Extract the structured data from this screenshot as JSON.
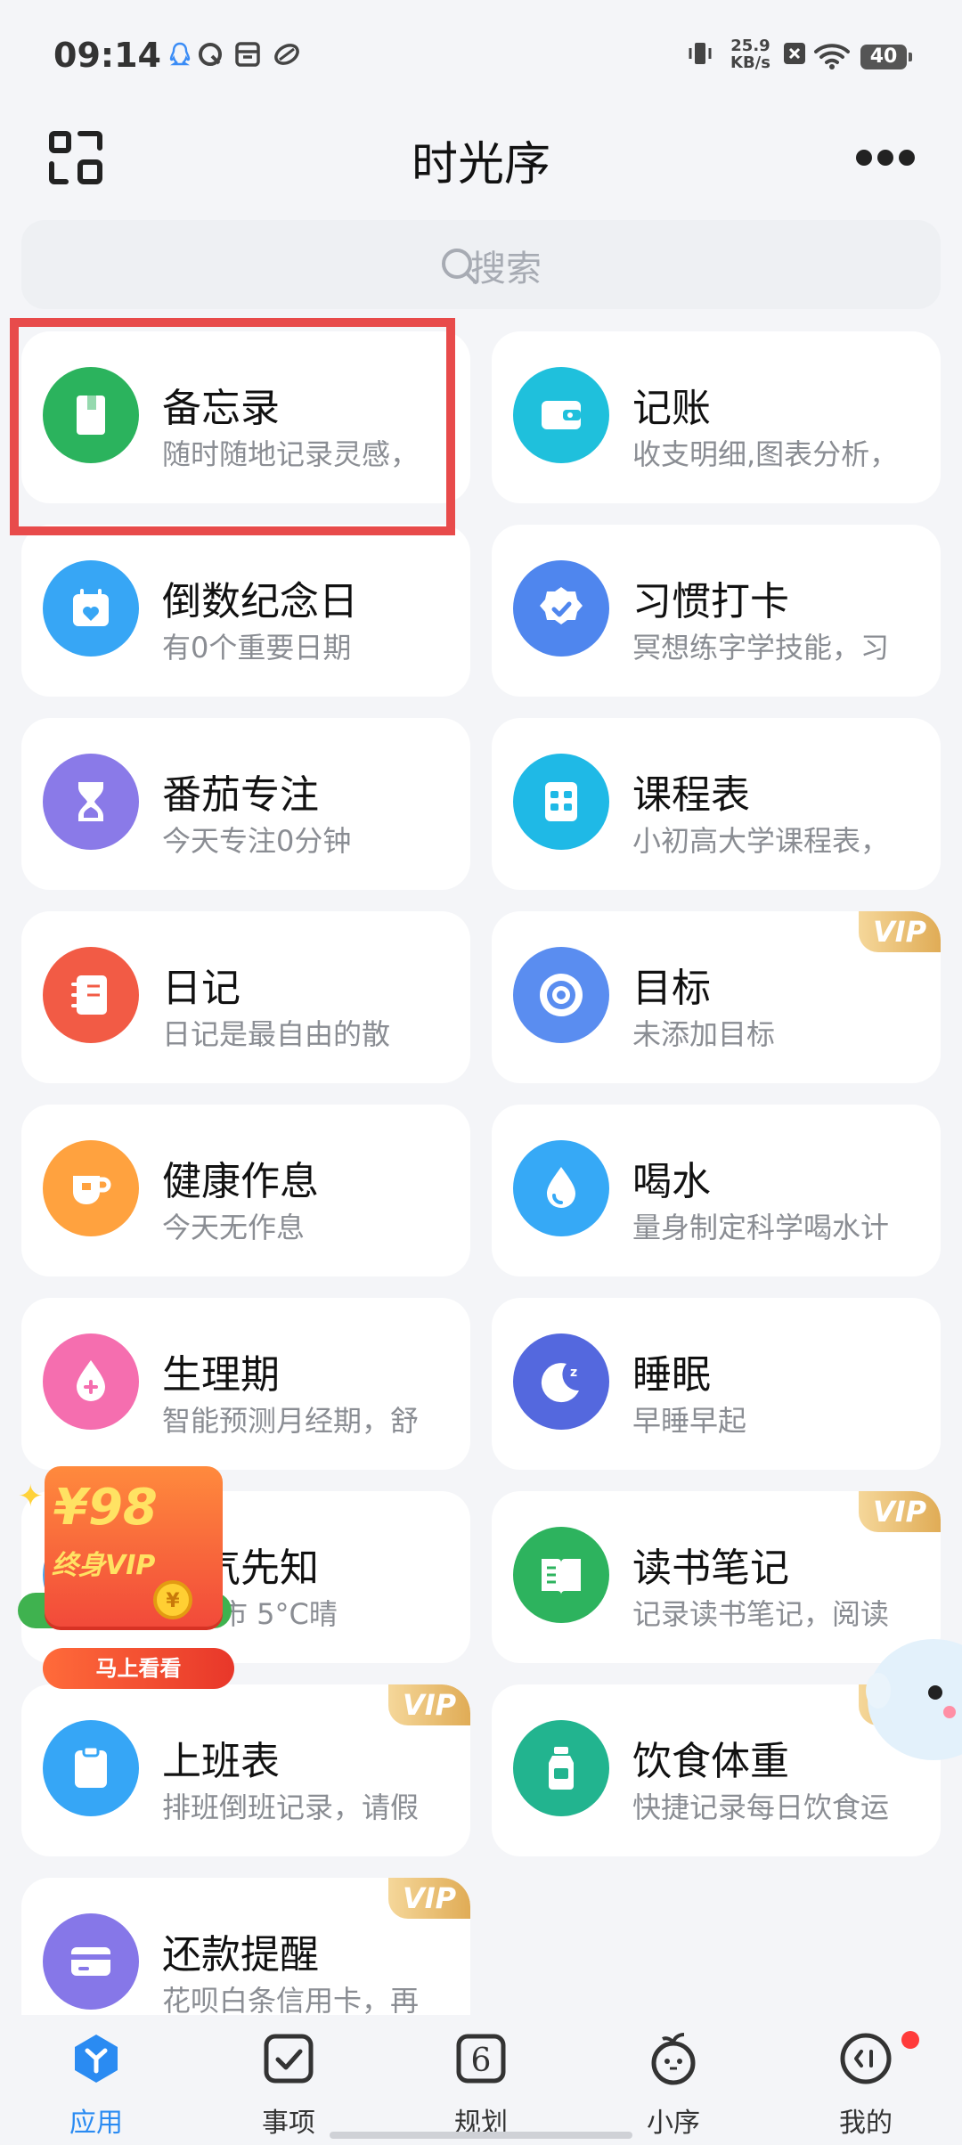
{
  "status_bar": {
    "time": "09:14",
    "net_speed_value": "25.9",
    "net_speed_unit": "KB/s",
    "battery": "40"
  },
  "header": {
    "title": "时光序"
  },
  "search": {
    "placeholder": "搜索"
  },
  "cards": [
    {
      "name": "备忘录",
      "desc": "随时随地记录灵感，",
      "icon": "notebook-icon",
      "color": "#2bb35d",
      "vip": ""
    },
    {
      "name": "记账",
      "desc": "收支明细,图表分析，",
      "icon": "wallet-icon",
      "color": "#1fc0dc",
      "vip": ""
    },
    {
      "name": "倒数纪念日",
      "desc": "有0个重要日期",
      "icon": "calendar-heart-icon",
      "color": "#37a6f5",
      "vip": ""
    },
    {
      "name": "习惯打卡",
      "desc": "冥想练字学技能，习",
      "icon": "badge-check-icon",
      "color": "#4f86ee",
      "vip": ""
    },
    {
      "name": "番茄专注",
      "desc": "今天专注0分钟",
      "icon": "hourglass-icon",
      "color": "#8a7ae8",
      "vip": ""
    },
    {
      "name": "课程表",
      "desc": "小初高大学课程表，",
      "icon": "timetable-icon",
      "color": "#1fb9e6",
      "vip": ""
    },
    {
      "name": "日记",
      "desc": "日记是最自由的散",
      "icon": "diary-icon",
      "color": "#f25b45",
      "vip": ""
    },
    {
      "name": "目标",
      "desc": "未添加目标",
      "icon": "target-icon",
      "color": "#5a8df0",
      "vip": "VIP"
    },
    {
      "name": "健康作息",
      "desc": "今天无作息",
      "icon": "cup-icon",
      "color": "#ffa23f",
      "vip": ""
    },
    {
      "name": "喝水",
      "desc": "量身制定科学喝水计",
      "icon": "water-drop-icon",
      "color": "#36a9f6",
      "vip": ""
    },
    {
      "name": "生理期",
      "desc": "智能预测月经期，舒",
      "icon": "period-drop-icon",
      "color": "#f56eaf",
      "vip": ""
    },
    {
      "name": "睡眠",
      "desc": "早睡早起",
      "icon": "moon-icon",
      "color": "#5468de",
      "vip": ""
    },
    {
      "name": "天气先知",
      "desc": "上海市 5°C晴",
      "icon": "weather-icon",
      "color": "#4aa8f0",
      "vip": ""
    },
    {
      "name": "读书笔记",
      "desc": "记录读书笔记，阅读",
      "icon": "book-icon",
      "color": "#2db35e",
      "vip": "VIP"
    },
    {
      "name": "上班表",
      "desc": "排班倒班记录，请假",
      "icon": "clipboard-icon",
      "color": "#36a6f6",
      "vip": "VIP"
    },
    {
      "name": "饮食体重",
      "desc": "快捷记录每日饮食运",
      "icon": "bottle-icon",
      "color": "#22b48f",
      "vip": "VIP"
    },
    {
      "name": "还款提醒",
      "desc": "花呗白条信用卡，再",
      "icon": "credit-card-icon",
      "color": "#8677e8",
      "vip": "VIP"
    }
  ],
  "promo": {
    "price": "¥98",
    "label": "终身VIP",
    "cta": "马上看看"
  },
  "tabs": [
    {
      "label": "应用",
      "icon": "apps-icon",
      "active": true
    },
    {
      "label": "事项",
      "icon": "checkbox-icon",
      "active": false
    },
    {
      "label": "规划",
      "icon": "plan-6-icon",
      "active": false
    },
    {
      "label": "小序",
      "icon": "mascot-icon",
      "active": false
    },
    {
      "label": "我的",
      "icon": "profile-icon",
      "active": false
    }
  ],
  "colors": {
    "accent": "#2a8bf2",
    "background": "#f4f5f8",
    "highlight": "#e84b4b"
  }
}
